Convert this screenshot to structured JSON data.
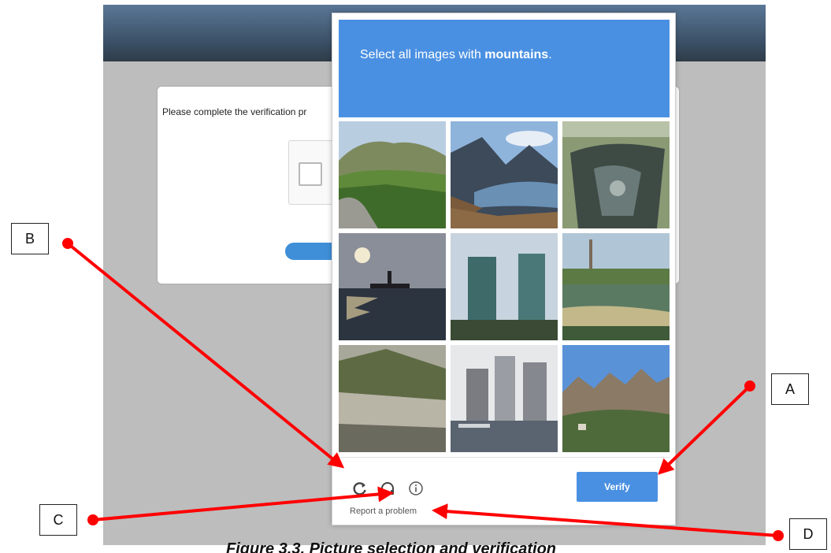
{
  "background_page": {
    "verification_text": "Please complete the verification pr"
  },
  "captcha": {
    "prompt_prefix": "Select all images with ",
    "prompt_keyword": "mountains",
    "prompt_suffix": ".",
    "tiles": [
      "mountain-valley",
      "mountain-lake",
      "pond",
      "sunset-statue",
      "twin-towers",
      "lake-shore",
      "hillside-town",
      "city-marina",
      "rocky-peaks"
    ],
    "report_label": "Report a problem",
    "verify_label": "Verify",
    "icons": [
      "reload-icon",
      "headphones-icon",
      "info-icon"
    ]
  },
  "callouts": {
    "a": "A",
    "b": "B",
    "c": "C",
    "d": "D"
  },
  "caption": "Figure 3.3. Picture selection and verification",
  "colors": {
    "header_blue": "#4a90e2",
    "arrow_red": "#ff0000"
  }
}
